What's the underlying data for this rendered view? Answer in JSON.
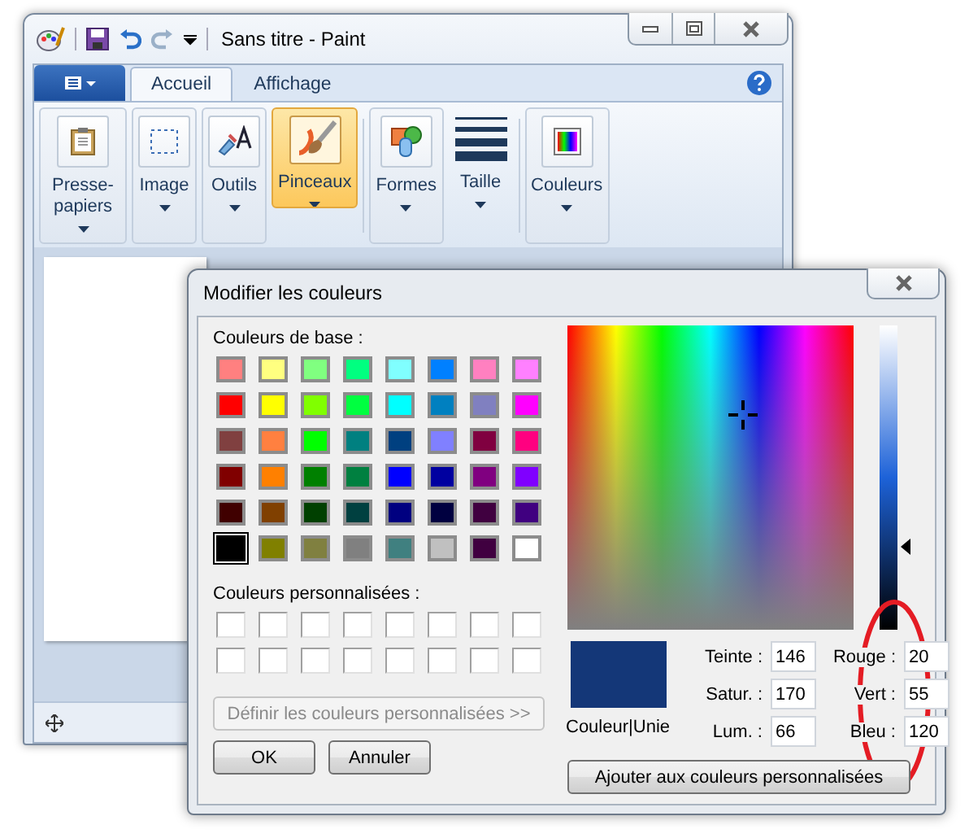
{
  "paint_window": {
    "title": "Sans titre - Paint",
    "tabs": [
      {
        "label": "Accueil",
        "selected": true
      },
      {
        "label": "Affichage",
        "selected": false
      }
    ],
    "ribbon_groups": [
      {
        "label": "Presse-papiers",
        "selected": false
      },
      {
        "label": "Image",
        "selected": false
      },
      {
        "label": "Outils",
        "selected": false
      },
      {
        "label": "Pinceaux",
        "selected": true
      },
      {
        "label": "Formes",
        "selected": false
      },
      {
        "label": "Taille",
        "selected": false
      },
      {
        "label": "Couleurs",
        "selected": false
      }
    ]
  },
  "color_dialog": {
    "title": "Modifier les couleurs",
    "base_colors_label": "Couleurs de base :",
    "base_colors": [
      {
        "color": "#ff8080",
        "selected": false
      },
      {
        "color": "#ffff80",
        "selected": false
      },
      {
        "color": "#80ff80",
        "selected": false
      },
      {
        "color": "#00ff80",
        "selected": false
      },
      {
        "color": "#80ffff",
        "selected": false
      },
      {
        "color": "#0080ff",
        "selected": false
      },
      {
        "color": "#ff80c0",
        "selected": false
      },
      {
        "color": "#ff80ff",
        "selected": false
      },
      {
        "color": "#ff0000",
        "selected": false
      },
      {
        "color": "#ffff00",
        "selected": false
      },
      {
        "color": "#80ff00",
        "selected": false
      },
      {
        "color": "#00ff40",
        "selected": false
      },
      {
        "color": "#00ffff",
        "selected": false
      },
      {
        "color": "#0080c0",
        "selected": false
      },
      {
        "color": "#8080c0",
        "selected": false
      },
      {
        "color": "#ff00ff",
        "selected": false
      },
      {
        "color": "#804040",
        "selected": false
      },
      {
        "color": "#ff8040",
        "selected": false
      },
      {
        "color": "#00ff00",
        "selected": false
      },
      {
        "color": "#008080",
        "selected": false
      },
      {
        "color": "#004080",
        "selected": false
      },
      {
        "color": "#8080ff",
        "selected": false
      },
      {
        "color": "#800040",
        "selected": false
      },
      {
        "color": "#ff0080",
        "selected": false
      },
      {
        "color": "#800000",
        "selected": false
      },
      {
        "color": "#ff8000",
        "selected": false
      },
      {
        "color": "#008000",
        "selected": false
      },
      {
        "color": "#008040",
        "selected": false
      },
      {
        "color": "#0000ff",
        "selected": false
      },
      {
        "color": "#0000a0",
        "selected": false
      },
      {
        "color": "#800080",
        "selected": false
      },
      {
        "color": "#8000ff",
        "selected": false
      },
      {
        "color": "#400000",
        "selected": false
      },
      {
        "color": "#804000",
        "selected": false
      },
      {
        "color": "#004000",
        "selected": false
      },
      {
        "color": "#004040",
        "selected": false
      },
      {
        "color": "#000080",
        "selected": false
      },
      {
        "color": "#000040",
        "selected": false
      },
      {
        "color": "#400040",
        "selected": false
      },
      {
        "color": "#400080",
        "selected": false
      },
      {
        "color": "#000000",
        "selected": true
      },
      {
        "color": "#808000",
        "selected": false
      },
      {
        "color": "#808040",
        "selected": false
      },
      {
        "color": "#808080",
        "selected": false
      },
      {
        "color": "#408080",
        "selected": false
      },
      {
        "color": "#c0c0c0",
        "selected": false
      },
      {
        "color": "#400040",
        "selected": false
      },
      {
        "color": "#ffffff",
        "selected": false
      }
    ],
    "custom_colors_label": "Couleurs personnalisées :",
    "custom_colors": [
      {
        "color": "#ffffff"
      },
      {
        "color": "#ffffff"
      },
      {
        "color": "#ffffff"
      },
      {
        "color": "#ffffff"
      },
      {
        "color": "#ffffff"
      },
      {
        "color": "#ffffff"
      },
      {
        "color": "#ffffff"
      },
      {
        "color": "#ffffff"
      },
      {
        "color": "#ffffff"
      },
      {
        "color": "#ffffff"
      },
      {
        "color": "#ffffff"
      },
      {
        "color": "#ffffff"
      },
      {
        "color": "#ffffff"
      },
      {
        "color": "#ffffff"
      },
      {
        "color": "#ffffff"
      },
      {
        "color": "#ffffff"
      }
    ],
    "define_button": {
      "label": "Définir les couleurs personnalisées >>",
      "disabled": true
    },
    "ok_button": "OK",
    "cancel_button": "Annuler",
    "luminance": {
      "level": 0.275
    },
    "preview": {
      "color": "#143778",
      "label": "Couleur|Unie"
    },
    "fields": [
      {
        "label": "Teinte :",
        "value": "146"
      },
      {
        "label": "Rouge :",
        "value": "20"
      },
      {
        "label": "Satur. :",
        "value": "170"
      },
      {
        "label": "Vert :",
        "value": "55"
      },
      {
        "label": "Lum. :",
        "value": "66"
      },
      {
        "label": "Bleu :",
        "value": "120"
      }
    ],
    "add_button": "Ajouter aux couleurs personnalisées"
  }
}
